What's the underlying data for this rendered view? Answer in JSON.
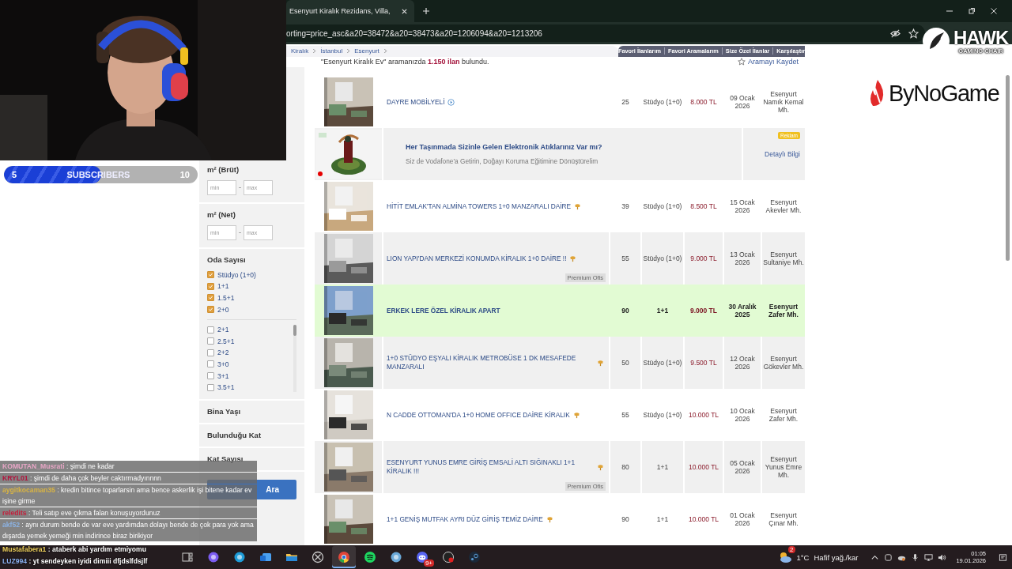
{
  "browser": {
    "tab_title": "Esenyurt Kiralık Rezidans, Villa,",
    "url": "orting=price_asc&a20=38472&a20=38473&a20=1206094&a20=1213206"
  },
  "breadcrumb": [
    "Kiralık",
    "İstanbul",
    "Esenyurt"
  ],
  "header_links": [
    "Favori İlanlarım",
    "Favori Aramalarım",
    "Size Özel İlanlar",
    "Karşılaştır"
  ],
  "summary": "\"Esenyurt Kiralık Ev\" aramanızda **1.150 ilan** bulundu.",
  "save_search": "Aramayı Kaydet",
  "filters": {
    "sections": [
      {
        "kind": "range",
        "title": "m² (Brüt)",
        "min_placeholder": "min",
        "max_placeholder": "max"
      },
      {
        "kind": "range",
        "title": "m² (Net)",
        "min_placeholder": "min",
        "max_placeholder": "max"
      },
      {
        "kind": "checklist",
        "title": "Oda Sayısı",
        "selected_options": [
          {
            "label": "Stüdyo (1+0)",
            "checked": true
          },
          {
            "label": "1+1",
            "checked": true
          },
          {
            "label": "1.5+1",
            "checked": true
          },
          {
            "label": "2+0",
            "checked": true
          }
        ],
        "options": [
          {
            "label": "2+1",
            "checked": false
          },
          {
            "label": "2.5+1",
            "checked": false
          },
          {
            "label": "2+2",
            "checked": false
          },
          {
            "label": "3+0",
            "checked": false
          },
          {
            "label": "3+1",
            "checked": false
          },
          {
            "label": "3.5+1",
            "checked": false
          }
        ]
      },
      {
        "kind": "collapsed",
        "title": "Bina Yaşı"
      },
      {
        "kind": "collapsed",
        "title": "Bulunduğu Kat"
      },
      {
        "kind": "collapsed",
        "title": "Kat Sayısı"
      }
    ],
    "search_button": "Ara"
  },
  "listings": [
    {
      "kind": "listing",
      "title": "DAYRE MOBİLYELİ",
      "has_video": true,
      "pinned": false,
      "area": "25",
      "rooms": "Stüdyo (1+0)",
      "price": "8.000 TL",
      "date": "09 Ocak 2026",
      "location": "Esenyurt Namık Kemal Mh.",
      "highlighted": false
    },
    {
      "kind": "ad",
      "title": "Her Taşınmada Sizinle Gelen Elektronik Atıklarınız Var mı?",
      "text": "Siz de Vodafone'a Getirin, Doğayı Koruma Eğitimine Dönüştürelim",
      "label": "Reklam",
      "link": "Detaylı Bilgi"
    },
    {
      "kind": "listing",
      "title": "HİTİT EMLAK'TAN ALMİNA TOWERS 1+0 MANZARALI DAİRE",
      "has_video": false,
      "pinned": true,
      "area": "39",
      "rooms": "Stüdyo (1+0)",
      "price": "8.500 TL",
      "date": "15 Ocak 2026",
      "location": "Esenyurt Akevler Mh.",
      "highlighted": false
    },
    {
      "kind": "listing",
      "title": "LION YAPI'DAN MERKEZİ KONUMDA KİRALIK 1+0 DAİRE !!",
      "has_video": false,
      "pinned": true,
      "area": "55",
      "rooms": "Stüdyo (1+0)",
      "price": "9.000 TL",
      "date": "13 Ocak 2026",
      "location": "Esenyurt Sultaniye Mh.",
      "highlighted": false,
      "badge": "Premium Ofis"
    },
    {
      "kind": "listing",
      "title": "ERKEK LERE ÖZEL KİRALIK APART",
      "has_video": false,
      "pinned": false,
      "area": "90",
      "rooms": "1+1",
      "price": "9.000 TL",
      "date": "30 Aralık 2025",
      "location": "Esenyurt Zafer Mh.",
      "highlighted": true
    },
    {
      "kind": "listing",
      "title": "1+0 STÜDYO EŞYALI KİRALIK METROBÜSE 1 DK MESAFEDE MANZARALI",
      "has_video": false,
      "pinned": true,
      "area": "50",
      "rooms": "Stüdyo (1+0)",
      "price": "9.500 TL",
      "date": "12 Ocak 2026",
      "location": "Esenyurt Gökevler Mh.",
      "highlighted": false
    },
    {
      "kind": "listing",
      "title": "N CADDE OTTOMAN'DA 1+0 HOME OFFICE DAİRE KİRALIK",
      "has_video": false,
      "pinned": true,
      "area": "55",
      "rooms": "Stüdyo (1+0)",
      "price": "10.000 TL",
      "date": "10 Ocak 2026",
      "location": "Esenyurt Zafer Mh.",
      "highlighted": false
    },
    {
      "kind": "listing",
      "title": "ESENYURT YUNUS EMRE GİRİŞ EMSALİ ALTI SIĞINAKLI 1+1 KİRALIK !!!",
      "has_video": false,
      "pinned": true,
      "area": "80",
      "rooms": "1+1",
      "price": "10.000 TL",
      "date": "05 Ocak 2026",
      "location": "Esenyurt Yunus Emre Mh.",
      "highlighted": false,
      "badge": "Premium Ofis"
    },
    {
      "kind": "listing",
      "title": "1+1 GENİŞ MUTFAK AYRI DÜZ GİRİŞ TEMİZ DAİRE",
      "has_video": false,
      "pinned": true,
      "area": "90",
      "rooms": "1+1",
      "price": "10.000 TL",
      "date": "01 Ocak 2026",
      "location": "Esenyurt Çınar Mh.",
      "highlighted": false
    }
  ],
  "stream": {
    "subscriber_goal": {
      "count": "5",
      "label": "SUBSCRIBERS",
      "goal": "10",
      "level": 0.5
    },
    "hawk": "HAWK",
    "hawk_tagline": "GAMING CHAIR",
    "sponsor": "ByNoGame",
    "chat": [
      {
        "user": "KOMUTAN_Musrati",
        "color": "#e8a6c6",
        "text": ": şimdi ne kadar",
        "boxed": true
      },
      {
        "user": "KRYL01",
        "color": "#b3123c",
        "text": ": şimdi de daha çok beyler caktırmadyınnnn",
        "boxed": true
      },
      {
        "user": "aygitkocaman35",
        "color": "#d9b443",
        "text": ": kredin bitince toparlarsin ama bence askerlik işi bitene kadar ev işine girme",
        "boxed": true
      },
      {
        "user": "reledits",
        "color": "#c3203c",
        "text": ": Teli satıp eve çıkma falan konuşuyordunuz",
        "boxed": true
      },
      {
        "user": "akf52",
        "color": "#8cb2e2",
        "text": ": aynı durum bende de var eve yardımdan dolayı bende de çok para yok ama dışarda yemek yemeği min indirince biraz birikiyor",
        "boxed": true
      },
      {
        "user": "Mustafabera1",
        "color": "#f2d35e",
        "text": ": ataberk abi yardım etmiyomu",
        "boxed": false
      },
      {
        "user": "LUZ994",
        "color": "#8cb2f2",
        "text": ": yt sendeyken iyidi dimiii dfjdslfdsjlf",
        "boxed": false
      }
    ]
  },
  "taskbar": {
    "apps": [
      {
        "kind": "taskview",
        "active": false
      },
      {
        "kind": "copilot",
        "active": false
      },
      {
        "kind": "edge",
        "active": false
      },
      {
        "kind": "outlook",
        "active": false
      },
      {
        "kind": "files",
        "active": false
      },
      {
        "kind": "xbox",
        "active": false
      },
      {
        "kind": "chrome",
        "active": true
      },
      {
        "kind": "spotify",
        "active": false
      },
      {
        "kind": "app",
        "active": false
      },
      {
        "kind": "discord",
        "active": false,
        "badge": "9+"
      },
      {
        "kind": "obs",
        "active": false
      },
      {
        "kind": "steam",
        "active": false
      }
    ],
    "weather": {
      "badge": "2",
      "temperature": "1°C",
      "condition": "Hafif yağ./kar"
    },
    "clock": {
      "time": "01:05",
      "date": "19.01.2026"
    }
  }
}
